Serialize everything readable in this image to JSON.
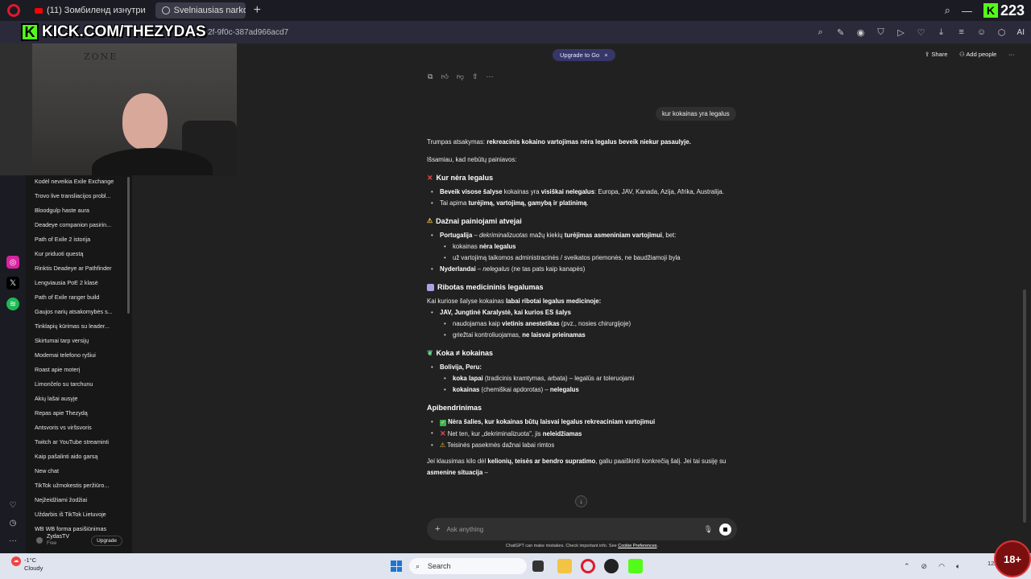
{
  "browser": {
    "tabs": [
      {
        "label": "(11) Зомбиленд изнутри"
      },
      {
        "label": "Svelniausias narkotikas"
      }
    ],
    "new_tab_symbol": "+",
    "url": "2f-9f0c-387ad966acd7",
    "kick_count": "223",
    "ai_label": "AI"
  },
  "webcam": {
    "kick_url": "KICK.COM/THEZYDAS",
    "kick_letter": "K",
    "wall_text": "ZONE"
  },
  "sidebar": {
    "chats": [
      "Kodėl neveikia Exile Exchange",
      "Trovo live transliacijos probl...",
      "Bloodgulp haste aura",
      "Deadeye companion pasirin...",
      "Path of Exile 2 istorija",
      "Kur priduoti questą",
      "Rinktis Deadeye ar Pathfinder",
      "Lengviausia PoE 2 klasė",
      "Path of Exile ranger build",
      "Gaujos narių atsakomybės s...",
      "Tinklapių kūrimas su leader...",
      "Skirtumai tarp versijų",
      "Modemai telefono ryšiui",
      "Roast apie moterį",
      "Limončelo su tarchunu",
      "Akių lašai ausyje",
      "Repas apie Thezydą",
      "Antsvoris vs viršsvoris",
      "Twitch ar YouTube streaminti",
      "Kaip pašalinti aido garsą",
      "New chat",
      "TikTok užmokestis peržiūro...",
      "Neįžeidžiami žodžiai",
      "Uždarbis iš TikTok Lietuvoje",
      "WB WB forma pasišiūnimas"
    ],
    "user_name": "ZydasTV",
    "user_plan": "Free",
    "upgrade_label": "Upgrade"
  },
  "header": {
    "upgrade_pill": "Upgrade to Go",
    "share_label": "Share",
    "add_people_label": "Add people",
    "more_symbol": "···"
  },
  "conversation": {
    "user_message": "kur kokainas yra legalus",
    "intro_prefix": "Trumpas atsakymas:",
    "intro_bold": "rekreacinis kokaino vartojimas nėra legalus beveik niekur pasaulyje.",
    "clarify": "Išsamiau, kad nebūtų painiavos:",
    "s1_title": "Kur nėra legalus",
    "s1_b1_bold1": "Beveik visose šalyse",
    "s1_b1_text1": " kokainas yra ",
    "s1_b1_bold2": "visiškai nelegalus",
    "s1_b1_text2": ": Europa, JAV, Kanada, Azija, Afrika, Australija.",
    "s1_b2_text": "Tai apima ",
    "s1_b2_bold": "turėjimą, vartojimą, gamybą ir platinimą",
    "s1_b2_end": ".",
    "s2_title": "Dažnai painiojami atvejai",
    "s2_b1_bold": "Portugalija",
    "s2_b1_dash": " – ",
    "s2_b1_italic": "dekriminalizuotas",
    "s2_b1_text": " mažų kiekių ",
    "s2_b1_bold2": "turėjimas asmeniniam vartojimui",
    "s2_b1_end": ", bet:",
    "s2_sub1_text": "kokainas ",
    "s2_sub1_bold": "nėra legalus",
    "s2_sub2": "už vartojimą taikomos administracinės / sveikatos priemonės, ne baudžiamoji byla",
    "s2_b2_bold": "Nyderlandai",
    "s2_b2_dash": " – ",
    "s2_b2_italic": "nelegalus",
    "s2_b2_text": " (ne tas pats kaip kanapės)",
    "s3_title": "Ribotas medicininis legalumas",
    "s3_intro_text": "Kai kuriose šalyse kokainas ",
    "s3_intro_bold": "labai ribotai legalus medicinoje:",
    "s3_b1_bold": "JAV, Jungtinė Karalystė, kai kurios ES šalys",
    "s3_sub1_text": "naudojamas kaip ",
    "s3_sub1_bold": "vietinis anestetikas",
    "s3_sub1_end": " (pvz., nosies chirurgijoje)",
    "s3_sub2_text": "griežtai kontroliuojamas, ",
    "s3_sub2_bold": "ne laisvai prieinamas",
    "s4_title": "Koka ≠ kokainas",
    "s4_b1_bold": "Bolivija, Peru:",
    "s4_sub1_bold": "koka lapai",
    "s4_sub1_text": " (tradicinis kramtymas, arbata) – legalūs ar toleruojami",
    "s4_sub2_bold": "kokainas",
    "s4_sub2_text": " (chemiškai apdorotas) – ",
    "s4_sub2_bold2": "nelegalus",
    "s5_title": "Apibendrinimas",
    "s5_b1_bold": "Nėra šalies, kur kokainas būtų laisvai legalus rekreaciniam vartojimui",
    "s5_b2_text": "Net ten, kur „dekriminalizuota\", jis ",
    "s5_b2_bold": "neleidžiamas",
    "s5_b3_text": "Teisinės pasekmės dažnai labai rimtos",
    "closing_text1": "Jei klausimas kilo dėl ",
    "closing_bold1": "kelionių, teisės ar bendro supratimo",
    "closing_text2": ", galiu paaiškinti konkrečią šalį. Jei tai susiję su ",
    "closing_bold2": "asmenine situacija",
    "closing_end": " –"
  },
  "composer": {
    "placeholder": "Ask anything",
    "disclaimer": "ChatGPT can make mistakes. Check important info. See ",
    "disclaimer_link": "Cookie Preferences",
    "disclaimer_end": "."
  },
  "taskbar": {
    "temperature": "-1°C",
    "weather": "Cloudy",
    "search_label": "Search",
    "date": "12/"
  },
  "age_badge": "18+",
  "colors": {
    "kick_green": "#53fc18",
    "upgrade_pill_bg": "#373669",
    "background": "#212121",
    "sidebar_bg": "#171717"
  }
}
